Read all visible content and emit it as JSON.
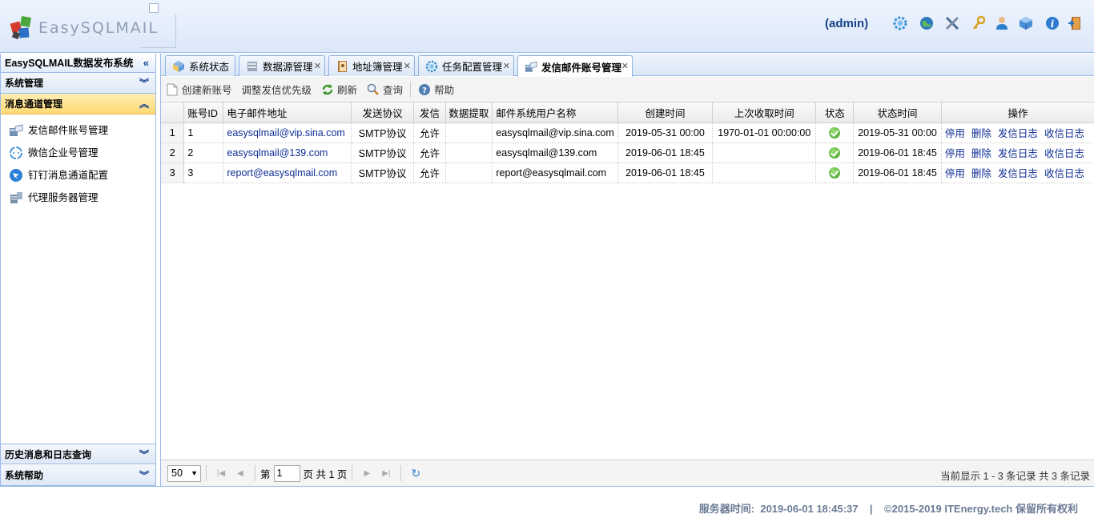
{
  "header": {
    "logo_text": "EasySQLMAIL",
    "user": "(admin)",
    "icons": [
      "gear-icon",
      "globe-icon",
      "tools-icon",
      "key-icon",
      "user-icon",
      "cube-icon",
      "info-icon",
      "exit-icon"
    ]
  },
  "sidebar": {
    "title": "EasySQLMAIL数据发布系统",
    "sections": {
      "system": "系统管理",
      "channel": "消息通道管理",
      "history": "历史消息和日志查询",
      "help": "系统帮助"
    },
    "items": [
      {
        "label": "发信邮件账号管理",
        "icon": "mail-server-icon"
      },
      {
        "label": "微信企业号管理",
        "icon": "wechat-icon"
      },
      {
        "label": "钉钉消息通道配置",
        "icon": "dingtalk-icon"
      },
      {
        "label": "代理服务器管理",
        "icon": "proxy-server-icon"
      }
    ]
  },
  "tabs": [
    {
      "label": "系统状态",
      "closable": false
    },
    {
      "label": "数据源管理",
      "closable": true
    },
    {
      "label": "地址簿管理",
      "closable": true
    },
    {
      "label": "任务配置管理",
      "closable": true
    },
    {
      "label": "发信邮件账号管理",
      "closable": true,
      "active": true
    }
  ],
  "toolbar": {
    "create": "创建新账号",
    "priority": "调整发信优先级",
    "refresh": "刷新",
    "query": "查询",
    "help": "帮助"
  },
  "grid": {
    "columns": [
      "账号ID",
      "电子邮件地址",
      "发送协议",
      "发信",
      "数据提取",
      "邮件系统用户名称",
      "创建时间",
      "上次收取时间",
      "状态",
      "状态时间",
      "操作"
    ],
    "rows": [
      {
        "num": "1",
        "id": "1",
        "email": "easysqlmail@vip.sina.com",
        "protocol": "SMTP协议",
        "send": "允许",
        "extract": "",
        "username": "easysqlmail@vip.sina.com",
        "created": "2019-05-31 00:00",
        "last_fetch": "1970-01-01 00:00:00",
        "status": "ok",
        "status_time": "2019-05-31 00:00"
      },
      {
        "num": "2",
        "id": "2",
        "email": "easysqlmail@139.com",
        "protocol": "SMTP协议",
        "send": "允许",
        "extract": "",
        "username": "easysqlmail@139.com",
        "created": "2019-06-01 18:45",
        "last_fetch": "",
        "status": "ok",
        "status_time": "2019-06-01 18:45"
      },
      {
        "num": "3",
        "id": "3",
        "email": "report@easysqlmail.com",
        "protocol": "SMTP协议",
        "send": "允许",
        "extract": "",
        "username": "report@easysqlmail.com",
        "created": "2019-06-01 18:45",
        "last_fetch": "",
        "status": "ok",
        "status_time": "2019-06-01 18:45"
      }
    ],
    "actions": [
      "停用",
      "删除",
      "发信日志",
      "收信日志"
    ]
  },
  "pager": {
    "page_size": "50",
    "page_label": "第",
    "page_value": "1",
    "page_suffix": "页 共 1 页",
    "info": "当前显示 1 - 3 条记录 共 3 条记录"
  },
  "footer": {
    "text": "服务器时间:  2019-06-01 18:45:37    |    ©2015-2019 ITEnergy.tech 保留所有权利"
  }
}
